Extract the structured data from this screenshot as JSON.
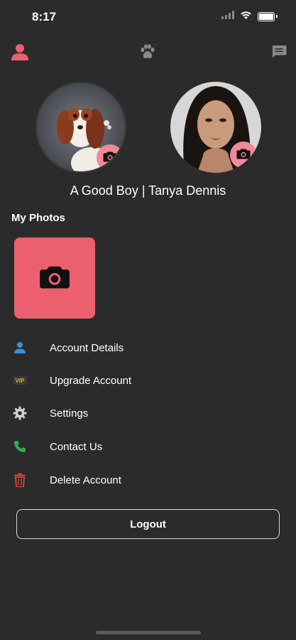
{
  "status": {
    "time": "8:17"
  },
  "profile": {
    "names": "A Good Boy | Tanya Dennis"
  },
  "photos": {
    "section_title": "My Photos"
  },
  "menu": [
    {
      "label": "Account Details",
      "icon": "person-icon",
      "color": "#3b8fd9"
    },
    {
      "label": "Upgrade Account",
      "icon": "vip-icon",
      "color": "#d9b23b"
    },
    {
      "label": "Settings",
      "icon": "gear-icon",
      "color": "#cfcfcf"
    },
    {
      "label": "Contact Us",
      "icon": "phone-icon",
      "color": "#34a853"
    },
    {
      "label": "Delete Account",
      "icon": "trash-icon",
      "color": "#e0443a"
    }
  ],
  "logout": {
    "label": "Logout"
  },
  "colors": {
    "accent": "#ec5f6f",
    "background": "#2b2b2b"
  },
  "vip_badge": "VIP"
}
